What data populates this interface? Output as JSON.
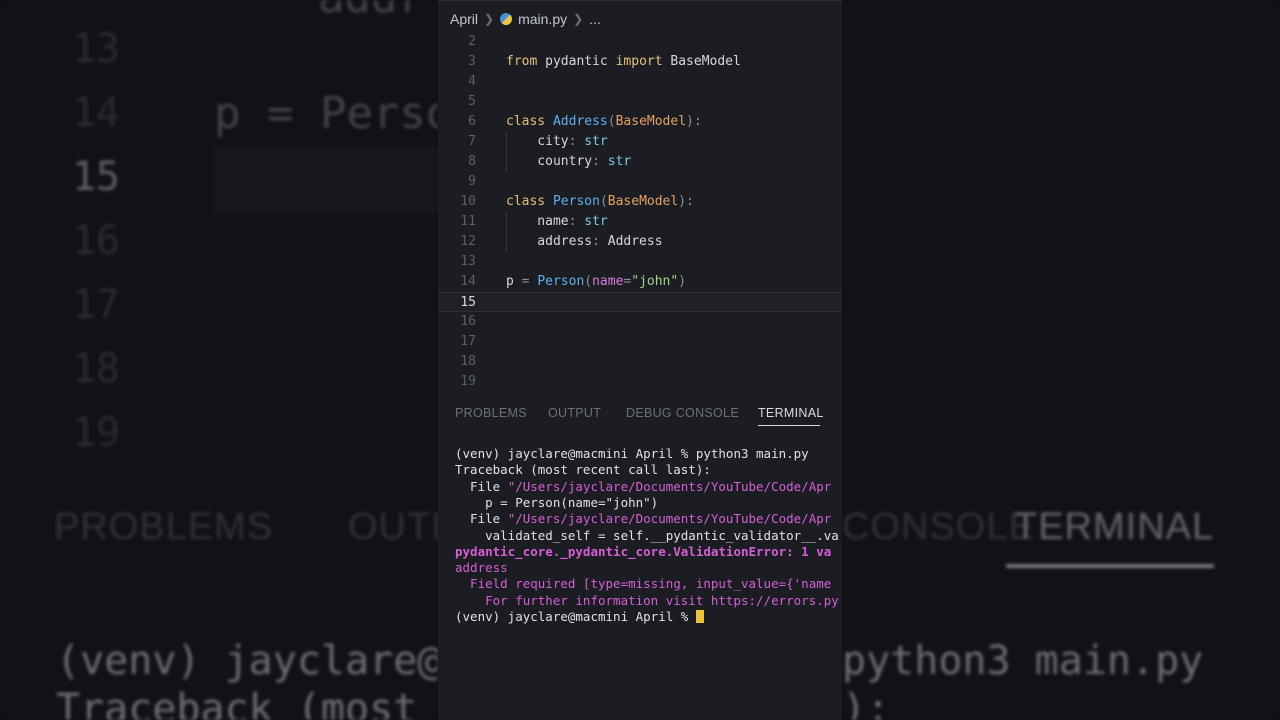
{
  "background": {
    "big_code_line": "p = Person",
    "big_code_top": "addr",
    "big_line_numbers": [
      "13",
      "14",
      "15",
      "16",
      "17",
      "18",
      "19"
    ],
    "big_tabs": [
      "PROBLEMS",
      "OUTPUT",
      "CONSOLE",
      "TERMINAL"
    ],
    "big_terminal_left": [
      "(venv) jayclare@",
      "Traceback (most"
    ],
    "big_terminal_right": [
      "python3 main.py",
      "):"
    ]
  },
  "breadcrumb": {
    "folder": "April",
    "file": "main.py",
    "more": "..."
  },
  "editor": {
    "current_line": "15",
    "lines": [
      {
        "n": "2",
        "tokens": []
      },
      {
        "n": "3",
        "tokens": [
          [
            "kw",
            "from"
          ],
          [
            "kw2",
            " pydantic "
          ],
          [
            "kw",
            "import"
          ],
          [
            "kw2",
            " BaseModel"
          ]
        ]
      },
      {
        "n": "4",
        "tokens": []
      },
      {
        "n": "5",
        "tokens": []
      },
      {
        "n": "6",
        "tokens": [
          [
            "kw",
            "class"
          ],
          [
            "kw2",
            " "
          ],
          [
            "cls",
            "Address"
          ],
          [
            "punc",
            "("
          ],
          [
            "base",
            "BaseModel"
          ],
          [
            "punc",
            "):"
          ]
        ]
      },
      {
        "n": "7",
        "tokens": [
          [
            "kw2",
            "    city"
          ],
          [
            "punc",
            ": "
          ],
          [
            "typ",
            "str"
          ]
        ]
      },
      {
        "n": "8",
        "tokens": [
          [
            "kw2",
            "    country"
          ],
          [
            "punc",
            ": "
          ],
          [
            "typ",
            "str"
          ]
        ]
      },
      {
        "n": "9",
        "tokens": []
      },
      {
        "n": "10",
        "tokens": [
          [
            "kw",
            "class"
          ],
          [
            "kw2",
            " "
          ],
          [
            "cls",
            "Person"
          ],
          [
            "punc",
            "("
          ],
          [
            "base",
            "BaseModel"
          ],
          [
            "punc",
            "):"
          ]
        ]
      },
      {
        "n": "11",
        "tokens": [
          [
            "kw2",
            "    name"
          ],
          [
            "punc",
            ": "
          ],
          [
            "typ",
            "str"
          ]
        ]
      },
      {
        "n": "12",
        "tokens": [
          [
            "kw2",
            "    address"
          ],
          [
            "punc",
            ": "
          ],
          [
            "kw2",
            "Address"
          ]
        ]
      },
      {
        "n": "13",
        "tokens": []
      },
      {
        "n": "14",
        "tokens": [
          [
            "kw2",
            "p "
          ],
          [
            "punc",
            "= "
          ],
          [
            "fn",
            "Person"
          ],
          [
            "punc",
            "("
          ],
          [
            "param",
            "name"
          ],
          [
            "punc",
            "="
          ],
          [
            "str",
            "\"john\""
          ],
          [
            "punc",
            ")"
          ]
        ]
      },
      {
        "n": "15",
        "tokens": []
      },
      {
        "n": "16",
        "tokens": []
      },
      {
        "n": "17",
        "tokens": []
      },
      {
        "n": "18",
        "tokens": []
      },
      {
        "n": "19",
        "tokens": []
      }
    ]
  },
  "panel": {
    "tabs": [
      "PROBLEMS",
      "OUTPUT",
      "DEBUG CONSOLE",
      "TERMINAL"
    ],
    "active_tab": "TERMINAL"
  },
  "terminal": {
    "lines": [
      {
        "style": "plain",
        "text": "(venv) jayclare@macmini April % python3 main.py"
      },
      {
        "style": "plain",
        "text": "Traceback (most recent call last):"
      },
      {
        "style": "file",
        "prefix": "  File ",
        "path": "\"/Users/jayclare/Documents/YouTube/Code/Apr"
      },
      {
        "style": "plain",
        "text": "    p = Person(name=\"john\")"
      },
      {
        "style": "file",
        "prefix": "  File ",
        "path": "\"/Users/jayclare/Documents/YouTube/Code/Apr"
      },
      {
        "style": "plain",
        "text": "    validated_self = self.__pydantic_validator__.va"
      },
      {
        "style": "bold",
        "text": "pydantic_core._pydantic_core.ValidationError: 1 va"
      },
      {
        "style": "magenta",
        "text": "address"
      },
      {
        "style": "magenta",
        "text": "  Field required [type=missing, input_value={'name"
      },
      {
        "style": "magenta",
        "text": "    For further information visit https://errors.py"
      },
      {
        "style": "prompt",
        "text": "(venv) jayclare@macmini April % "
      }
    ]
  },
  "colors": {
    "editor_bg": "#1b1d22",
    "keyword": "#e6c07b",
    "class_name": "#61afef",
    "error": "#d55fd5",
    "cursor": "#e8c43c"
  }
}
